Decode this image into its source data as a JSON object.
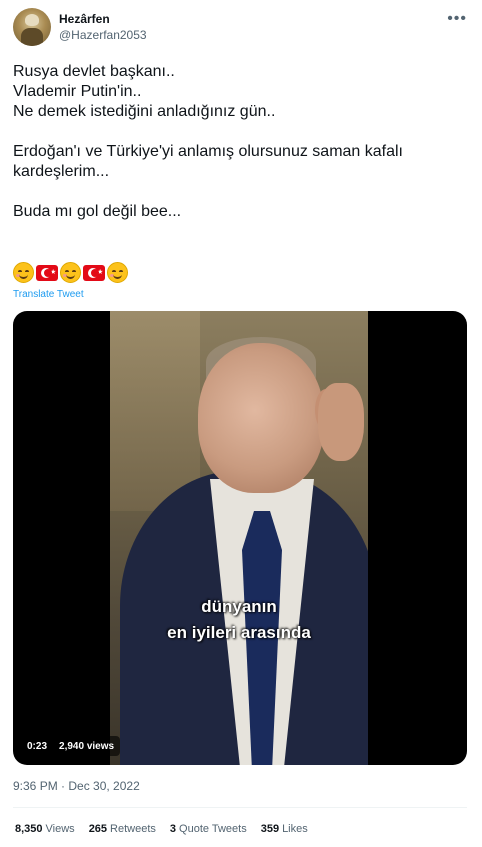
{
  "user": {
    "name": "Hezârfen",
    "handle": "@Hazerfan2053"
  },
  "tweet": {
    "lines": [
      "Rusya devlet başkanı..",
      "Vlademir Putin'in..",
      "Ne demek istediğini anladığınız gün..",
      "",
      "Erdoğan'ı ve Türkiye'yi anlamış olursunuz saman kafalı kardeşlerim...",
      "",
      "Buda mı gol değil bee..."
    ],
    "emojis": [
      "smiling-face-icon",
      "turkey-flag-icon",
      "smiling-face-icon",
      "turkey-flag-icon",
      "smiling-face-icon"
    ],
    "translate_label": "Translate Tweet"
  },
  "media": {
    "subtitle_line1": "dünyanın",
    "subtitle_line2": "en iyileri arasında",
    "duration": "0:23",
    "views": "2,940 views"
  },
  "timestamp": "9:36 PM · Dec 30, 2022",
  "stats": {
    "views_count": "8,350",
    "views_label": "Views",
    "retweets_count": "265",
    "retweets_label": "Retweets",
    "quotes_count": "3",
    "quotes_label": "Quote Tweets",
    "likes_count": "359",
    "likes_label": "Likes"
  }
}
